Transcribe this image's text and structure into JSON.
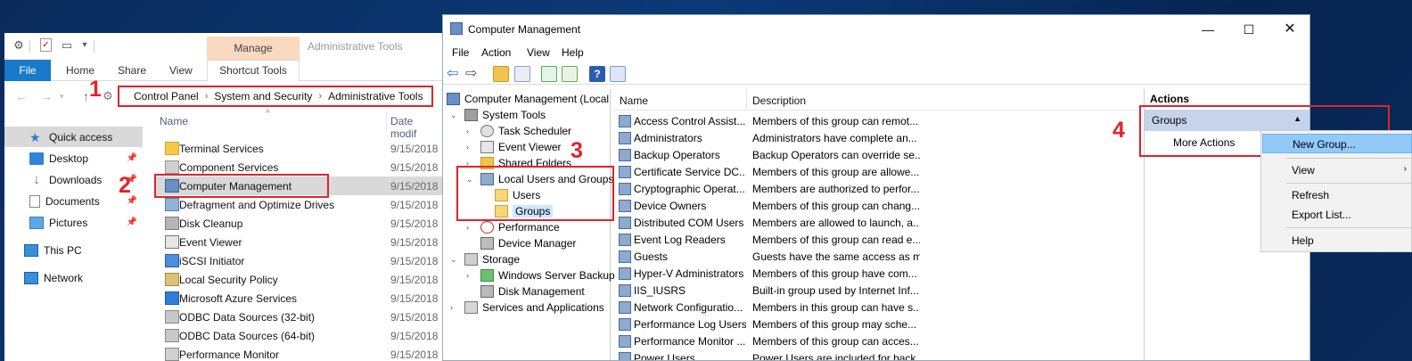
{
  "explorer": {
    "ribbon": {
      "manage_label": "Manage",
      "title": "Administrative Tools",
      "tabs": [
        "File",
        "Home",
        "Share",
        "View"
      ],
      "shortcut_tools": "Shortcut Tools"
    },
    "address": {
      "breadcrumbs": [
        "Control Panel",
        "System and Security",
        "Administrative Tools"
      ]
    },
    "nav": [
      {
        "label": "Quick access",
        "icon": "star-icon"
      },
      {
        "label": "Desktop",
        "icon": "desktop-icon"
      },
      {
        "label": "Downloads",
        "icon": "download-icon"
      },
      {
        "label": "Documents",
        "icon": "documents-icon"
      },
      {
        "label": "Pictures",
        "icon": "pictures-icon"
      },
      {
        "label": "This PC",
        "icon": "computer-icon"
      },
      {
        "label": "Network",
        "icon": "network-icon"
      }
    ],
    "columns": {
      "name": "Name",
      "date": "Date modif"
    },
    "files": [
      {
        "name": "Terminal Services",
        "date": "9/15/2018"
      },
      {
        "name": "Component Services",
        "date": "9/15/2018"
      },
      {
        "name": "Computer Management",
        "date": "9/15/2018"
      },
      {
        "name": "Defragment and Optimize Drives",
        "date": "9/15/2018"
      },
      {
        "name": "Disk Cleanup",
        "date": "9/15/2018"
      },
      {
        "name": "Event Viewer",
        "date": "9/15/2018"
      },
      {
        "name": "iSCSI Initiator",
        "date": "9/15/2018"
      },
      {
        "name": "Local Security Policy",
        "date": "9/15/2018"
      },
      {
        "name": "Microsoft Azure Services",
        "date": "9/15/2018"
      },
      {
        "name": "ODBC Data Sources (32-bit)",
        "date": "9/15/2018"
      },
      {
        "name": "ODBC Data Sources (64-bit)",
        "date": "9/15/2018"
      },
      {
        "name": "Performance Monitor",
        "date": "9/15/2018"
      }
    ]
  },
  "annotations": {
    "one": "1",
    "two": "2",
    "three": "3",
    "four": "4"
  },
  "cm": {
    "title": "Computer Management",
    "menu": [
      "File",
      "Action",
      "View",
      "Help"
    ],
    "tree": [
      "Computer Management (Local",
      "System Tools",
      "Task Scheduler",
      "Event Viewer",
      "Shared Folders",
      "Local Users and Groups",
      "Users",
      "Groups",
      "Performance",
      "Device Manager",
      "Storage",
      "Windows Server Backup",
      "Disk Management",
      "Services and Applications"
    ],
    "list_columns": {
      "name": "Name",
      "description": "Description"
    },
    "groups": [
      {
        "name": "Access Control Assist...",
        "desc": "Members of this group can remot..."
      },
      {
        "name": "Administrators",
        "desc": "Administrators have complete an..."
      },
      {
        "name": "Backup Operators",
        "desc": "Backup Operators can override se..."
      },
      {
        "name": "Certificate Service DC...",
        "desc": "Members of this group are allowe..."
      },
      {
        "name": "Cryptographic Operat...",
        "desc": "Members are authorized to perfor..."
      },
      {
        "name": "Device Owners",
        "desc": "Members of this group can chang..."
      },
      {
        "name": "Distributed COM Users",
        "desc": "Members are allowed to launch, a..."
      },
      {
        "name": "Event Log Readers",
        "desc": "Members of this group can read e..."
      },
      {
        "name": "Guests",
        "desc": "Guests have the same access as m..."
      },
      {
        "name": "Hyper-V Administrators",
        "desc": "Members of this group have com..."
      },
      {
        "name": "IIS_IUSRS",
        "desc": "Built-in group used by Internet Inf..."
      },
      {
        "name": "Network Configuratio...",
        "desc": "Members in this group can have s..."
      },
      {
        "name": "Performance Log Users",
        "desc": "Members of this group may sche..."
      },
      {
        "name": "Performance Monitor ...",
        "desc": "Members of this group can acces..."
      },
      {
        "name": "Power Users",
        "desc": "Power Users are included for back..."
      }
    ],
    "actions": {
      "header": "Actions",
      "groups": "Groups",
      "more": "More Actions"
    }
  },
  "context_menu": {
    "items": [
      "New Group...",
      "View",
      "Refresh",
      "Export List...",
      "Help"
    ]
  }
}
